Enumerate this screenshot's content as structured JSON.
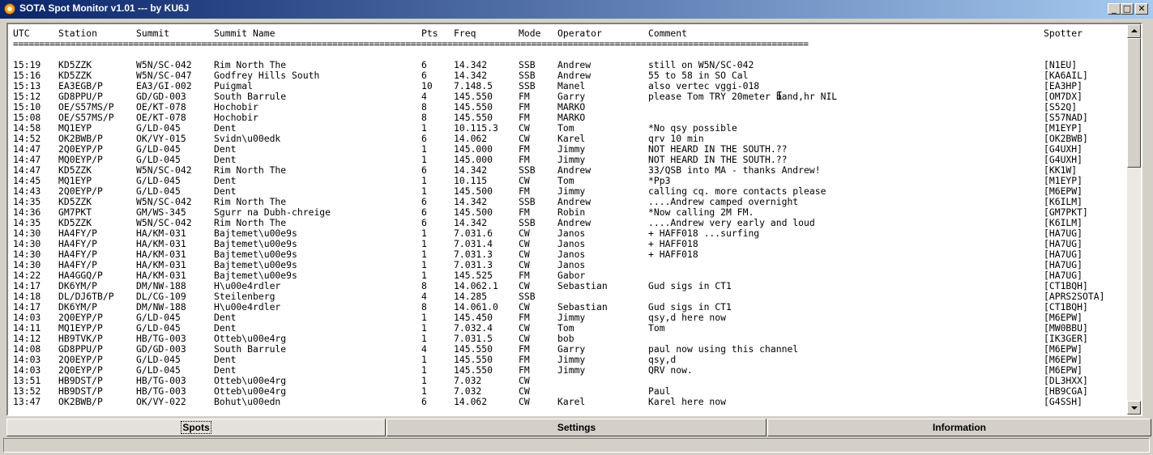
{
  "window": {
    "title": "SOTA Spot Monitor v1.01 --- by KU6J",
    "controls": {
      "minimize": "_",
      "maximize": "□",
      "close": "✕"
    }
  },
  "columns": {
    "utc": "UTC",
    "station": "Station",
    "summit": "Summit",
    "summit_name": "Summit Name",
    "pts": "Pts",
    "freq": "Freq",
    "mode": "Mode",
    "operator": "Operator",
    "comment": "Comment",
    "spotter": "Spotter"
  },
  "separator": "========================================================================================================================================================",
  "spots": [
    [
      "15:19",
      "KD5ZZK",
      "W5N/SC-042",
      "Rim North The",
      "6",
      "14.342",
      "SSB",
      "Andrew",
      "still on W5N/SC-042",
      "[N1EU]"
    ],
    [
      "15:16",
      "KD5ZZK",
      "W5N/SC-047",
      "Godfrey Hills South",
      "6",
      "14.342",
      "SSB",
      "Andrew",
      "55 to 58 in SO Cal",
      "[KA6AIL]"
    ],
    [
      "15:13",
      "EA3EGB/P",
      "EA3/GI-002",
      "Puigmal",
      "10",
      "7.148.5",
      "SSB",
      "Manel",
      "also vertec vggi-018",
      "[EA3HP]"
    ],
    [
      "15:12",
      "GD8PPU/P",
      "GD/GD-003",
      "South Barrule",
      "4",
      "145.550",
      "FM",
      "Garry",
      "please Tom TRY 20meter band,hr NIL",
      "[OM7DX]"
    ],
    [
      "15:10",
      "OE/S57MS/P",
      "OE/KT-078",
      "Hochobir",
      "8",
      "145.550",
      "FM",
      "MARKO",
      "",
      "[S52Q]"
    ],
    [
      "15:08",
      "OE/S57MS/P",
      "OE/KT-078",
      "Hochobir",
      "8",
      "145.550",
      "FM",
      "MARKO",
      "",
      "[S57NAD]"
    ],
    [
      "14:58",
      "MQ1EYP",
      "G/LD-045",
      "Dent",
      "1",
      "10.115.3",
      "CW",
      "Tom",
      "*No qsy possible",
      "[M1EYP]"
    ],
    [
      "14:52",
      "OK2BWB/P",
      "OK/VY-015",
      "Svidn\\u00edk",
      "6",
      "14.062",
      "CW",
      "Karel",
      "qrv 10 min",
      "[OK2BWB]"
    ],
    [
      "14:47",
      "2Q0EYP/P",
      "G/LD-045",
      "Dent",
      "1",
      "145.000",
      "FM",
      "Jimmy",
      "NOT HEARD IN THE SOUTH.??",
      "[G4UXH]"
    ],
    [
      "14:47",
      "MQ0EYP/P",
      "G/LD-045",
      "Dent",
      "1",
      "145.000",
      "FM",
      "Jimmy",
      "NOT HEARD IN THE SOUTH.??",
      "[G4UXH]"
    ],
    [
      "14:47",
      "KD5ZZK",
      "W5N/SC-042",
      "Rim North The",
      "6",
      "14.342",
      "SSB",
      "Andrew",
      "33/QSB into MA - thanks Andrew!",
      "[KK1W]"
    ],
    [
      "14:45",
      "MQ1EYP",
      "G/LD-045",
      "Dent",
      "1",
      "10.115",
      "CW",
      "Tom",
      "*Pp3",
      "[M1EYP]"
    ],
    [
      "14:43",
      "2Q0EYP/P",
      "G/LD-045",
      "Dent",
      "1",
      "145.500",
      "FM",
      "Jimmy",
      "calling cq. more contacts please",
      "[M6EPW]"
    ],
    [
      "14:35",
      "KD5ZZK",
      "W5N/SC-042",
      "Rim North The",
      "6",
      "14.342",
      "SSB",
      "Andrew",
      "....Andrew camped overnight",
      "[K6ILM]"
    ],
    [
      "14:36",
      "GM7PKT",
      "GM/WS-345",
      "Sgurr na Dubh-chreige",
      "6",
      "145.500",
      "FM",
      "Robin",
      "*Now calling 2M FM.",
      "[GM7PKT]"
    ],
    [
      "14:35",
      "KD5ZZK",
      "W5N/SC-042",
      "Rim North The",
      "6",
      "14.342",
      "SSB",
      "Andrew",
      "....Andrew very early and loud",
      "[K6ILM]"
    ],
    [
      "14:30",
      "HA4FY/P",
      "HA/KM-031",
      "Bajtemet\\u00e9s",
      "1",
      "7.031.6",
      "CW",
      "Janos",
      "+ HAFF018 ...surfing",
      "[HA7UG]"
    ],
    [
      "14:30",
      "HA4FY/P",
      "HA/KM-031",
      "Bajtemet\\u00e9s",
      "1",
      "7.031.4",
      "CW",
      "Janos",
      "+ HAFF018",
      "[HA7UG]"
    ],
    [
      "14:30",
      "HA4FY/P",
      "HA/KM-031",
      "Bajtemet\\u00e9s",
      "1",
      "7.031.3",
      "CW",
      "Janos",
      "+ HAFF018",
      "[HA7UG]"
    ],
    [
      "14:30",
      "HA4FY/P",
      "HA/KM-031",
      "Bajtemet\\u00e9s",
      "1",
      "7.031.3",
      "CW",
      "Janos",
      "",
      "[HA7UG]"
    ],
    [
      "14:22",
      "HA4GGQ/P",
      "HA/KM-031",
      "Bajtemet\\u00e9s",
      "1",
      "145.525",
      "FM",
      "Gabor",
      "",
      "[HA7UG]"
    ],
    [
      "14:17",
      "DK6YM/P",
      "DM/NW-188",
      "H\\u00e4rdler",
      "8",
      "14.062.1",
      "CW",
      "Sebastian",
      "Gud sigs in CT1",
      "[CT1BQH]"
    ],
    [
      "14:18",
      "DL/DJ6TB/P",
      "DL/CG-109",
      "Steilenberg",
      "4",
      "14.285",
      "SSB",
      "",
      "",
      "[APRS2SOTA]"
    ],
    [
      "14:17",
      "DK6YM/P",
      "DM/NW-188",
      "H\\u00e4rdler",
      "8",
      "14.061.0",
      "CW",
      "Sebastian",
      "Gud sigs in CT1",
      "[CT1BQH]"
    ],
    [
      "14:03",
      "2Q0EYP/P",
      "G/LD-045",
      "Dent",
      "1",
      "145.450",
      "FM",
      "Jimmy",
      "qsy,d here now",
      "[M6EPW]"
    ],
    [
      "14:11",
      "MQ1EYP/P",
      "G/LD-045",
      "Dent",
      "1",
      "7.032.4",
      "CW",
      "Tom",
      "Tom",
      "[MW0BBU]"
    ],
    [
      "14:12",
      "HB9TVK/P",
      "HB/TG-003",
      "Otteb\\u00e4rg",
      "1",
      "7.031.5",
      "CW",
      "bob",
      "",
      "[IK3GER]"
    ],
    [
      "14:08",
      "GD8PPU/P",
      "GD/GD-003",
      "South Barrule",
      "4",
      "145.550",
      "FM",
      "Garry",
      "paul now using this channel",
      "[M6EPW]"
    ],
    [
      "14:03",
      "2Q0EYP/P",
      "G/LD-045",
      "Dent",
      "1",
      "145.550",
      "FM",
      "Jimmy",
      "qsy,d",
      "[M6EPW]"
    ],
    [
      "14:03",
      "2Q0EYP/P",
      "G/LD-045",
      "Dent",
      "1",
      "145.550",
      "FM",
      "Jimmy",
      "QRV now.",
      "[M6EPW]"
    ],
    [
      "13:51",
      "HB9DST/P",
      "HB/TG-003",
      "Otteb\\u00e4rg",
      "1",
      "7.032",
      "CW",
      "",
      "",
      "[DL3HXX]"
    ],
    [
      "13:52",
      "HB9DST/P",
      "HB/TG-003",
      "Otteb\\u00e4rg",
      "1",
      "7.032",
      "CW",
      "",
      "Paul",
      "[HB9CGA]"
    ],
    [
      "13:47",
      "OK2BWB/P",
      "OK/VY-022",
      "Bohut\\u00edn",
      "6",
      "14.062",
      "CW",
      "Karel",
      "Karel here now",
      "[G4SSH]"
    ]
  ],
  "tabs": {
    "spots": "Spots",
    "settings": "Settings",
    "information": "Information"
  }
}
